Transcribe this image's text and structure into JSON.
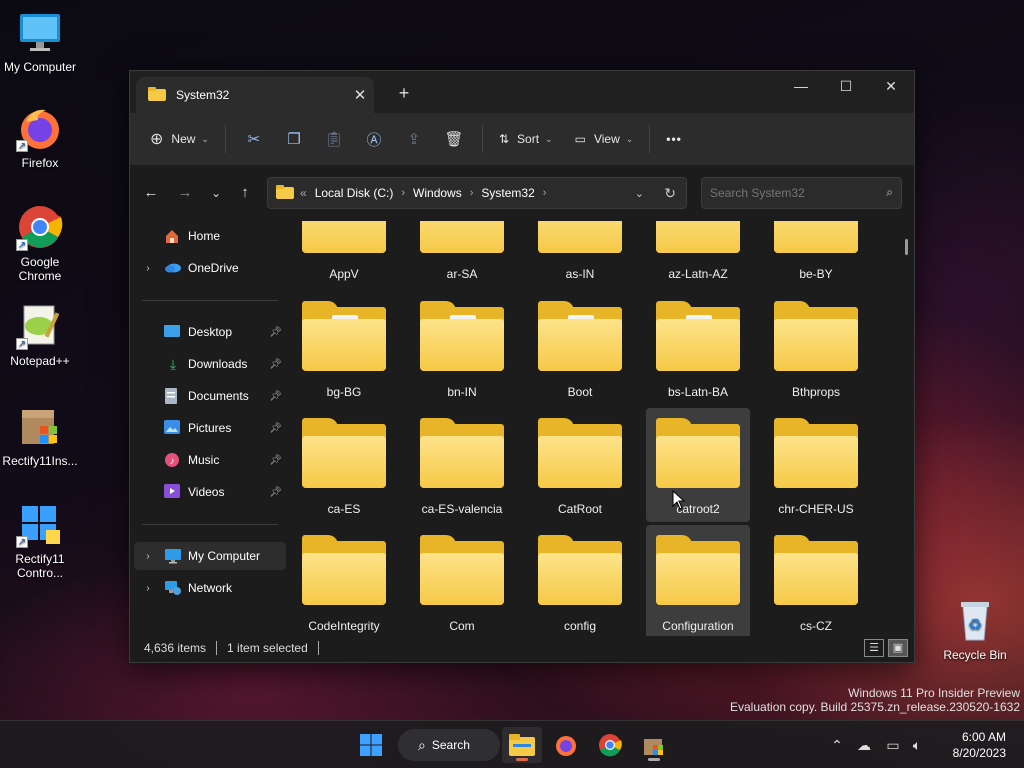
{
  "desktop": {
    "icons": [
      {
        "label": "My Computer"
      },
      {
        "label": "Firefox"
      },
      {
        "label": "Google Chrome"
      },
      {
        "label": "Notepad++"
      },
      {
        "label": "Rectify11Ins..."
      },
      {
        "label": "Rectify11 Contro..."
      },
      {
        "label": "Recycle Bin"
      }
    ],
    "watermark": {
      "line1": "Windows 11 Pro Insider Preview",
      "line2": "Evaluation copy. Build 25375.zn_release.230520-1632"
    }
  },
  "window": {
    "tab_title": "System32",
    "new_tab_icon": "+",
    "controls": {
      "minimize": "—",
      "maximize": "☐",
      "close": "✕"
    },
    "toolbar": {
      "new_label": "New",
      "sort_label": "Sort",
      "view_label": "View",
      "more_label": "•••"
    },
    "address": {
      "overflow": "«",
      "crumbs": [
        "Local Disk (C:)",
        "Windows",
        "System32"
      ]
    },
    "search": {
      "placeholder": "Search System32"
    },
    "sidebar": {
      "home": "Home",
      "onedrive": "OneDrive",
      "quick": [
        {
          "label": "Desktop"
        },
        {
          "label": "Downloads"
        },
        {
          "label": "Documents"
        },
        {
          "label": "Pictures"
        },
        {
          "label": "Music"
        },
        {
          "label": "Videos"
        }
      ],
      "my_computer": "My Computer",
      "network": "Network"
    },
    "folders": [
      {
        "name": "AppV",
        "has_files": false
      },
      {
        "name": "ar-SA",
        "has_files": false
      },
      {
        "name": "as-IN",
        "has_files": false
      },
      {
        "name": "az-Latn-AZ",
        "has_files": false
      },
      {
        "name": "be-BY",
        "has_files": false
      },
      {
        "name": "bg-BG",
        "has_files": true
      },
      {
        "name": "bn-IN",
        "has_files": true
      },
      {
        "name": "Boot",
        "has_files": true
      },
      {
        "name": "bs-Latn-BA",
        "has_files": true
      },
      {
        "name": "Bthprops",
        "has_files": false
      },
      {
        "name": "ca-ES",
        "has_files": false
      },
      {
        "name": "ca-ES-valencia",
        "has_files": false
      },
      {
        "name": "CatRoot",
        "has_files": false
      },
      {
        "name": "catroot2",
        "has_files": false,
        "hovered": true
      },
      {
        "name": "chr-CHER-US",
        "has_files": false
      },
      {
        "name": "CodeIntegrity",
        "has_files": false
      },
      {
        "name": "Com",
        "has_files": false
      },
      {
        "name": "config",
        "has_files": false
      },
      {
        "name": "Configuration",
        "has_files": false,
        "selected": true
      },
      {
        "name": "cs-CZ",
        "has_files": false
      }
    ],
    "status": {
      "item_count": "4,636 items",
      "selection": "1 item selected"
    }
  },
  "taskbar": {
    "search_label": "Search",
    "clock_time": "6:00 AM",
    "clock_date": "8/20/2023"
  },
  "colors": {
    "folder_back": "#e8b528",
    "folder_front": "#f6c946",
    "accent": "#0078d4"
  }
}
